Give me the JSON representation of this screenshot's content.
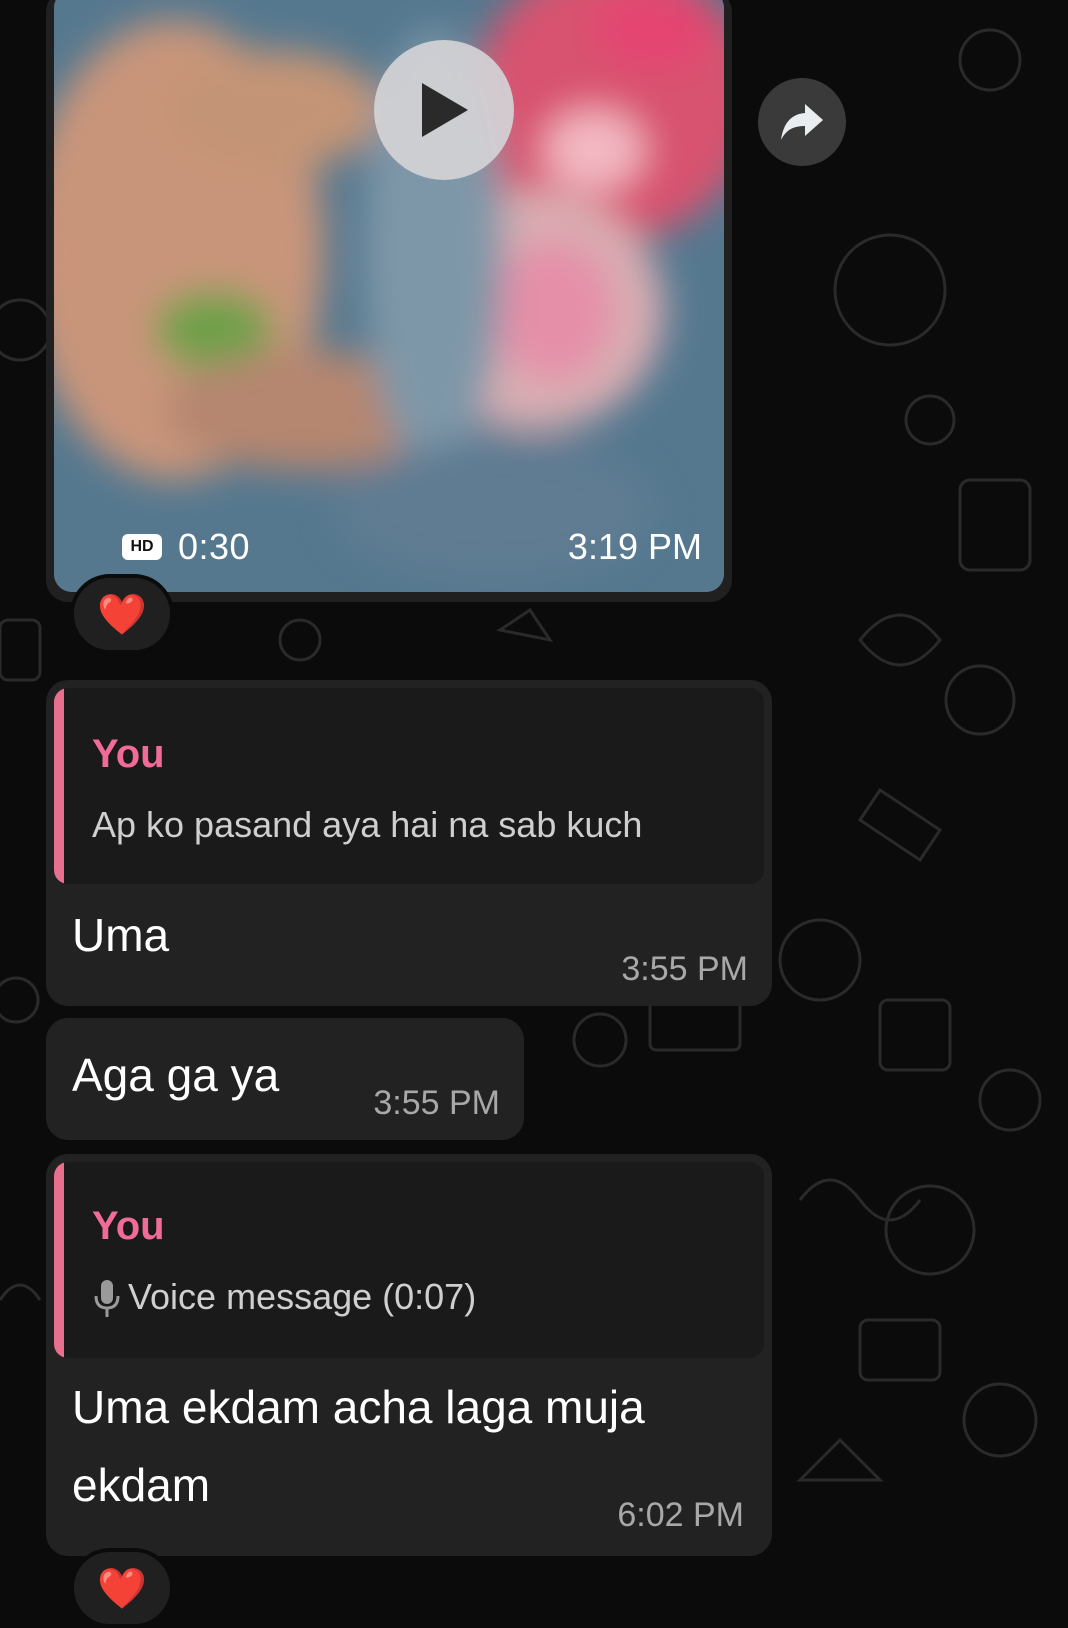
{
  "video_message": {
    "quality_badge": "HD",
    "duration": "0:30",
    "time": "3:19 PM"
  },
  "reaction_1": {
    "emoji": "❤️"
  },
  "reply_message_1": {
    "quoted_author": "You",
    "quoted_text": "Ap ko pasand aya hai na sab kuch",
    "text": "Uma",
    "time": "3:55 PM"
  },
  "message_2": {
    "text": "Aga ga ya",
    "time": "3:55 PM"
  },
  "reply_message_2": {
    "quoted_author": "You",
    "quoted_text": "Voice message (0:07)",
    "text_line1": "Uma ekdam acha laga muja",
    "text_line2": "ekdam",
    "time": "6:02 PM"
  },
  "reaction_2": {
    "emoji": "❤️"
  },
  "colors": {
    "background": "#0b0b0b",
    "bubble": "#222222",
    "quote_accent": "#f06b97",
    "reaction_heart": "#e8222e"
  },
  "icons": [
    "play-icon",
    "forward-icon",
    "heart-icon",
    "microphone-icon",
    "hd-icon"
  ]
}
